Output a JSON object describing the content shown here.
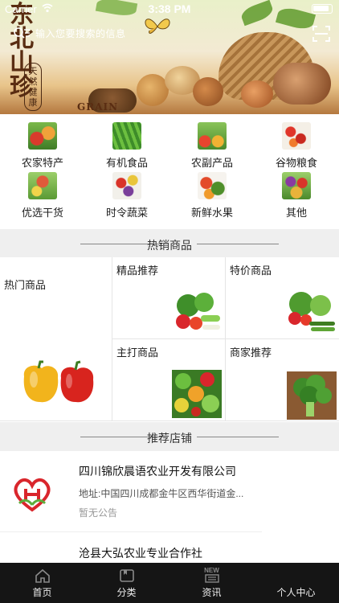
{
  "status_bar": {
    "carrier": "Carrier",
    "time": "3:38 PM"
  },
  "banner": {
    "search_placeholder": "输入您要搜索的信息",
    "calligraphy": "东北山珍",
    "seal_text": "天然健康",
    "brand_en": "GRAIN"
  },
  "categories": [
    {
      "label": "农家特产",
      "icon": "farm-specialty-icon"
    },
    {
      "label": "有机食品",
      "icon": "organic-food-icon"
    },
    {
      "label": "农副产品",
      "icon": "agricultural-byproduct-icon"
    },
    {
      "label": "谷物粮食",
      "icon": "grain-icon"
    },
    {
      "label": "优选干货",
      "icon": "dried-goods-icon"
    },
    {
      "label": "时令蔬菜",
      "icon": "seasonal-vegetables-icon"
    },
    {
      "label": "新鲜水果",
      "icon": "fresh-fruit-icon"
    },
    {
      "label": "其他",
      "icon": "other-icon"
    }
  ],
  "hot_section": {
    "title": "热销商品",
    "items": [
      {
        "label": "热门商品",
        "image": "bell-peppers"
      },
      {
        "label": "精品推荐",
        "image": "mixed-vegetables"
      },
      {
        "label": "特价商品",
        "image": "vegetable-assortment"
      },
      {
        "label": "主打商品",
        "image": "vegetable-box"
      },
      {
        "label": "商家推荐",
        "image": "broccoli"
      }
    ]
  },
  "store_section": {
    "title": "推荐店铺",
    "stores": [
      {
        "name": "四川锦欣晨语农业开发有限公司",
        "address": "地址:中国四川成都金牛区西华街道金...",
        "notice": "暂无公告",
        "logo": "heart-leaf-logo"
      },
      {
        "name": "沧县大弘农业专业合作社",
        "address": "",
        "notice": "",
        "logo": "store-logo"
      }
    ]
  },
  "tabbar": [
    {
      "label": "首页",
      "icon": "home-icon"
    },
    {
      "label": "分类",
      "icon": "category-icon"
    },
    {
      "label": "资讯",
      "icon": "news-icon",
      "icon_text": "NEW"
    },
    {
      "label": "个人中心",
      "icon": "profile-icon"
    }
  ],
  "colors": {
    "tab_background": "#151515",
    "section_background": "#efefef",
    "logo_red": "#d9262c",
    "logo_green": "#5cae3c"
  }
}
